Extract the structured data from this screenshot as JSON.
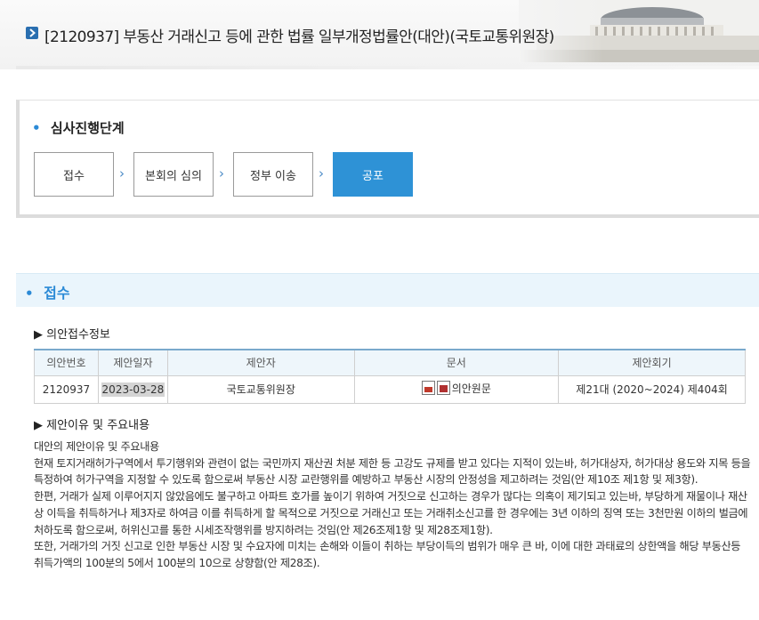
{
  "header": {
    "title": "[2120937] 부동산 거래신고 등에 관한 법률 일부개정법률안(대안)(국토교통위원장)"
  },
  "progress": {
    "dot": "•",
    "heading": "심사진행단계",
    "stages": [
      {
        "label": "접수"
      },
      {
        "label": "본회의 심의"
      },
      {
        "label": "정부 이송"
      },
      {
        "label": "공포"
      }
    ],
    "arrow": "›"
  },
  "receipt": {
    "dot": "•",
    "title": "접수",
    "info_heading": "▶ 의안접수정보",
    "table": {
      "headers": [
        "의안번호",
        "제안일자",
        "제안자",
        "문서",
        "제안회기"
      ],
      "row": {
        "bill_no": "2120937",
        "date": "2023-03-28",
        "proposer": "국토교통위원장",
        "doc": "의안원문",
        "session": "제21대 (2020~2024) 제404회"
      }
    },
    "reason_heading": "▶ 제안이유 및 주요내용",
    "reason_lines": [
      "대안의 제안이유 및 주요내용",
      "현재 토지거래허가구역에서 투기행위와 관련이 없는 국민까지 재산권 처분 제한 등 고강도 규제를 받고 있다는 지적이 있는바, 허가대상자, 허가대상 용도와 지목 등을 특정하여 허가구역을 지정할 수 있도록 함으로써 부동산 시장 교란행위를 예방하고 부동산 시장의 안정성을 제고하려는 것임(안 제10조 제1항 및 제3항).",
      "한편, 거래가 실제 이루어지지 않았음에도 불구하고 아파트 호가를 높이기 위하여 거짓으로 신고하는 경우가 많다는 의혹이 제기되고 있는바, 부당하게 재물이나 재산상 이득을 취득하거나 제3자로 하여금 이를 취득하게 할 목적으로 거짓으로 거래신고 또는 거래취소신고를 한 경우에는 3년 이하의 징역 또는 3천만원 이하의 벌금에 처하도록 함으로써, 허위신고를 통한 시세조작행위를 방지하려는 것임(안 제26조제1항 및 제28조제1항).",
      "또한, 거래가의 거짓 신고로 인한 부동산 시장 및 수요자에 미치는 손해와 이들이 취하는 부당이득의 범위가 매우 큰 바, 이에 대한 과태료의 상한액을 해당 부동산등 취득가액의 100분의 5에서 100분의 10으로 상향함(안 제28조)."
    ]
  }
}
